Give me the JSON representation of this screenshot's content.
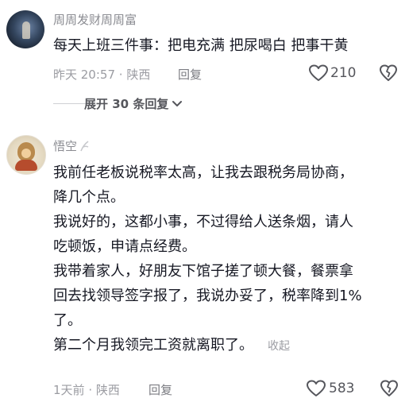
{
  "comment1": {
    "username": "周周发财周周富",
    "text": "每天上班三件事：把电充满 把尿喝白 把事干黄",
    "time": "昨天 20:57",
    "dot": "·",
    "location": "陕西",
    "reply_label": "回复",
    "likes": "210",
    "expand_label": "展开 30 条回复"
  },
  "comment2": {
    "username": "悟空",
    "text_lines": [
      "我前任老板说税率太高，让我去跟税务局协商，",
      "降几个点。",
      "我说好的，这都小事，不过得给人送条烟，请人",
      "吃顿饭，申请点经费。",
      "我带着家人，好朋友下馆子搓了顿大餐，餐票拿",
      "回去找领导签字报了，我说办妥了，税率降到1%",
      "了。",
      "第二个月我领完工资就离职了。"
    ],
    "collapse_label": "收起",
    "time": "1天前",
    "dot": "·",
    "location": "陕西",
    "reply_label": "回复",
    "likes": "583"
  },
  "icons": {
    "like": "heart-outline-icon",
    "dislike": "broken-heart-icon",
    "expand": "chevron-down-icon",
    "badge": "level-badge-icon"
  },
  "colors": {
    "primary_text": "#161823",
    "secondary_text": "#8a8b91",
    "meta_text": "#9b9ca2"
  }
}
